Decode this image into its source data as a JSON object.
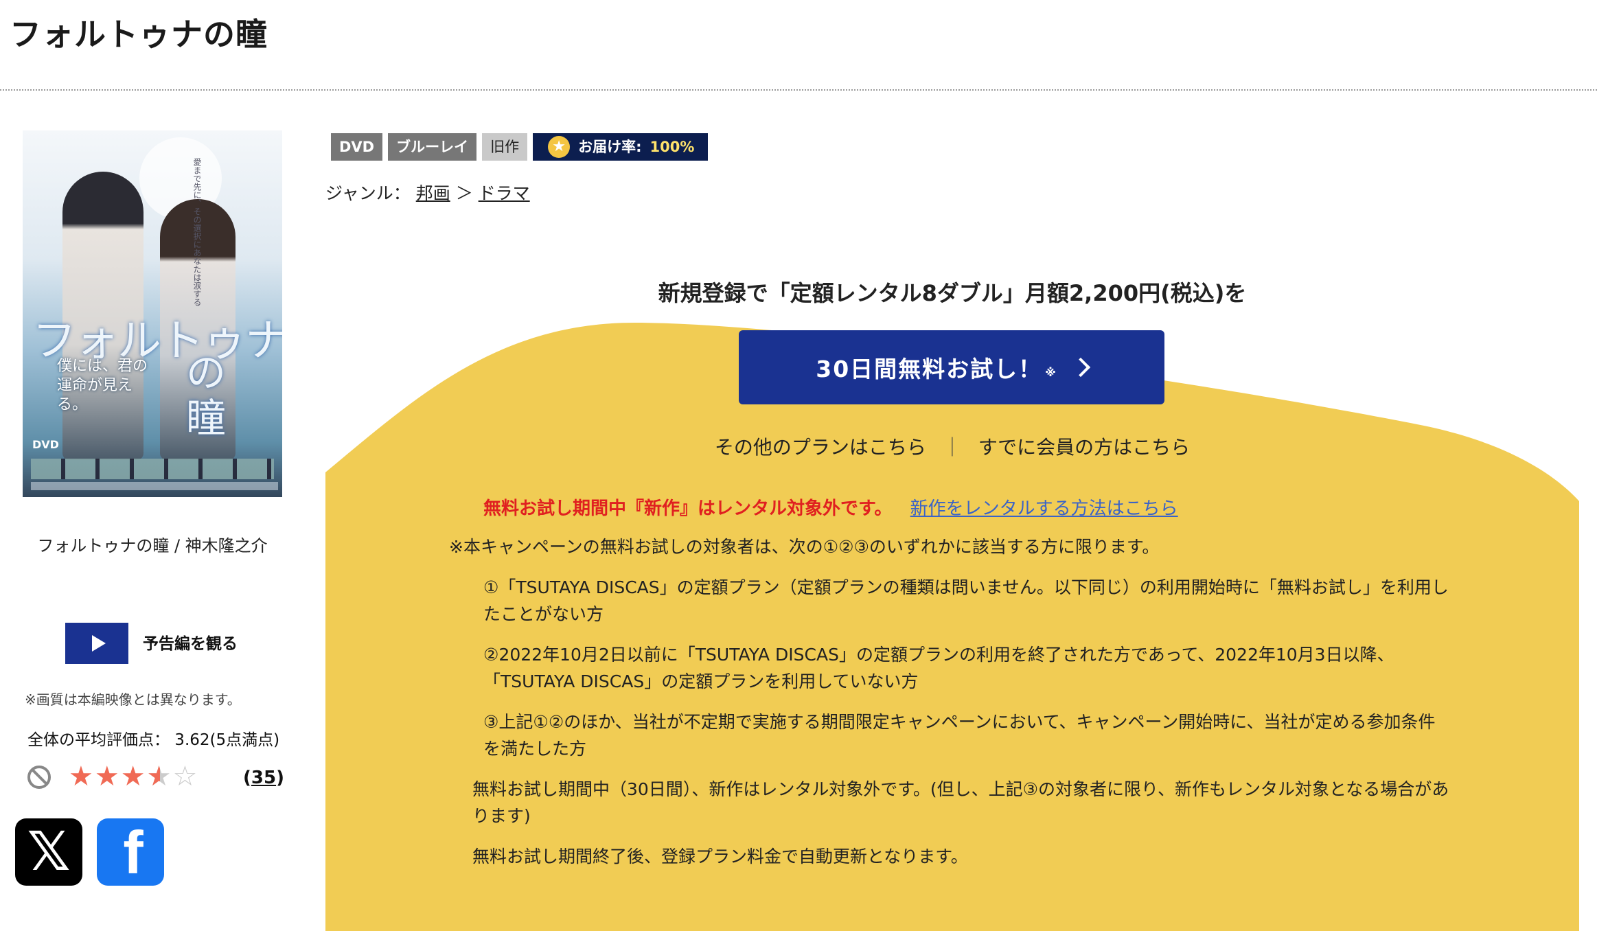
{
  "page": {
    "title": "フォルトゥナの瞳"
  },
  "poster": {
    "title_line1": "フォルトゥナ",
    "title_line2": "の\n瞳",
    "tagline": "僕には、君の運命が見える。",
    "vertical_text": "愛まで先に、その選択にあなたは涙する",
    "dvd_mark": "DVD"
  },
  "left": {
    "caption": "フォルトゥナの瞳 / 神木隆之介",
    "trailer_label": "予告編を観る",
    "quality_note": "※画質は本編映像とは異なります。",
    "avg_rating_text": "全体の平均評価点： 3.62(5点満点)",
    "avg_rating_value": 3.62,
    "stars": {
      "full": "★★★",
      "half": "★",
      "empty": "☆"
    },
    "review_count_open": "(",
    "review_count": "35",
    "review_count_close": ")",
    "x_glyph": "𝕏",
    "fb_glyph": "f"
  },
  "badges": {
    "dvd": "DVD",
    "bluray": "ブルーレイ",
    "old": "旧作",
    "delivery_label": "お届け率:",
    "delivery_value": "100%"
  },
  "genre": {
    "label": "ジャンル：",
    "item1": "邦画",
    "sep": "＞",
    "item2": "ドラマ"
  },
  "promo": {
    "headline": "新規登録で「定額レンタル8ダブル」月額2,200円(税込)を",
    "trial_button": "30日間無料お試し！",
    "trial_mark": "※",
    "other_plans": "その他のプランはこちら",
    "separator": "｜",
    "member_link": "すでに会員の方はこちら",
    "warning": "無料お試し期間中『新作』はレンタル対象外です。",
    "warning_link": "新作をレンタルする方法はこちら",
    "note_intro": "※本キャンペーンの無料お試しの対象者は、次の①②③のいずれかに該当する方に限ります。",
    "cond1": "①「TSUTAYA DISCAS」の定額プラン（定額プランの種類は問いません。以下同じ）の利用開始時に「無料お試し」を利用したことがない方",
    "cond2": "②2022年10月2日以前に「TSUTAYA DISCAS」の定額プランの利用を終了された方であって、2022年10月3日以降、「TSUTAYA DISCAS」の定額プランを利用していない方",
    "cond3": "③上記①②のほか、当社が不定期で実施する期間限定キャンペーンにおいて、キャンペーン開始時に、当社が定める参加条件を満たした方",
    "trial_note": "無料お試し期間中（30日間）、新作はレンタル対象外です。(但し、上記③の対象者に限り、新作もレンタル対象となる場合があります)",
    "renew_note": "無料お試し期間終了後、登録プラン料金で自動更新となります。"
  },
  "colors": {
    "accent_blue": "#1a3291",
    "promo_yellow": "#f1cc54",
    "warning_red": "#e02020",
    "link_blue": "#3a63c8"
  }
}
